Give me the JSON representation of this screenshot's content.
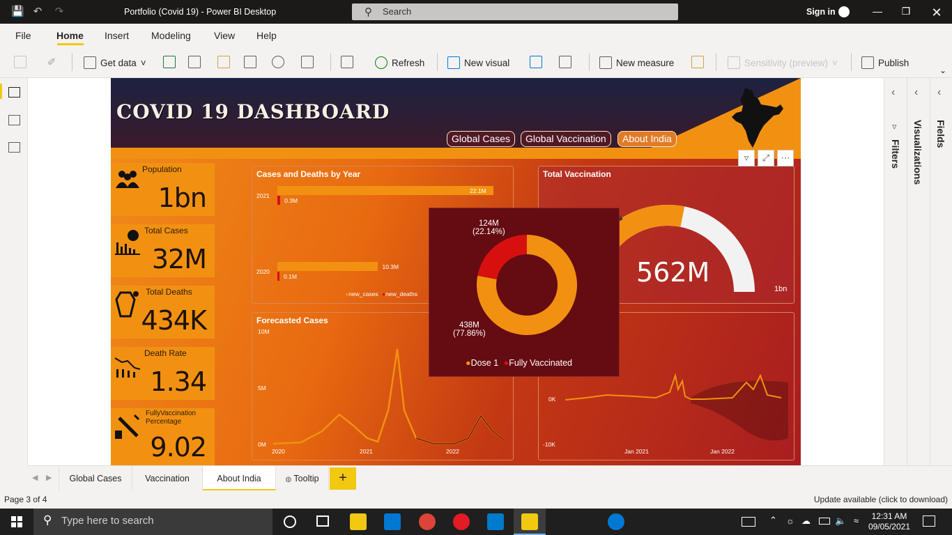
{
  "window": {
    "title": "Portfolio (Covid 19) - Power BI Desktop",
    "search_placeholder": "Search",
    "signin": "Sign in"
  },
  "menu": [
    "File",
    "Home",
    "Insert",
    "Modeling",
    "View",
    "Help"
  ],
  "ribbon": {
    "get_data": "Get data",
    "refresh": "Refresh",
    "new_visual": "New visual",
    "new_measure": "New measure",
    "sensitivity": "Sensitivity (preview)",
    "publish": "Publish"
  },
  "dashboard": {
    "title": "COVID 19 DASHBOARD",
    "nav": [
      "Global Cases",
      "Global Vaccination",
      "About India"
    ],
    "kpis": [
      {
        "label": "Population",
        "value": "1bn"
      },
      {
        "label": "Total Cases",
        "value": "32M"
      },
      {
        "label": "Total Deaths",
        "value": "434K"
      },
      {
        "label": "Death Rate",
        "value": "1.34"
      },
      {
        "label": "FullyVaccination Percentage",
        "value": "9.02"
      }
    ],
    "cases_deaths": {
      "title": "Cases and Deaths by Year",
      "years": [
        "2021",
        "2020"
      ],
      "new_cases_labels": [
        "22.1M",
        "10.3M"
      ],
      "new_deaths_labels": [
        "0.3M",
        "0.1M"
      ],
      "legend": [
        "new_cases",
        "new_deaths"
      ]
    },
    "total_vaccination": {
      "title": "Total Vaccination",
      "value": "562M",
      "max_label": "1bn"
    },
    "forecast": {
      "title": "Forecasted Cases",
      "yticks": [
        "10M",
        "5M",
        "0M"
      ],
      "xticks": [
        "2020",
        "2021",
        "2022"
      ]
    },
    "right_chart": {
      "yticks": [
        "0K",
        "-10K"
      ],
      "xticks": [
        "Jan 2021",
        "Jan 2022"
      ]
    },
    "tooltip": {
      "top_label": "124M",
      "top_pct": "(22.14%)",
      "bottom_label": "438M",
      "bottom_pct": "(77.86%)",
      "legend": [
        "Dose 1",
        "Fully Vaccinated"
      ]
    }
  },
  "colors": {
    "accent": "#f2c811",
    "orange": "#f29111",
    "red": "#d7100f",
    "dark_red": "#650b12"
  },
  "chart_data": [
    {
      "type": "bar",
      "title": "Cases and Deaths by Year",
      "categories": [
        "2021",
        "2020"
      ],
      "series": [
        {
          "name": "new_cases",
          "values": [
            22.1,
            10.3
          ]
        },
        {
          "name": "new_deaths",
          "values": [
            0.3,
            0.1
          ]
        }
      ],
      "unit": "M",
      "legend": "bottom-right"
    },
    {
      "type": "pie",
      "categories": [
        "Dose 1",
        "Fully Vaccinated"
      ],
      "values": [
        438,
        124
      ],
      "percentages": [
        77.86,
        22.14
      ],
      "unit": "M",
      "legend": "bottom"
    },
    {
      "type": "line",
      "title": "Forecasted Cases",
      "ylim": [
        0,
        10
      ],
      "unit": "M",
      "x": [
        "2020",
        "2021",
        "2022"
      ]
    }
  ],
  "side_panes": [
    "Filters",
    "Visualizations",
    "Fields"
  ],
  "tabs": [
    "Global Cases",
    "Vaccination",
    "About India",
    "Tooltip"
  ],
  "status": {
    "page": "Page 3 of 4",
    "update": "Update available (click to download)"
  },
  "taskbar": {
    "search": "Type here to search",
    "time": "12:31 AM",
    "date": "09/05/2021"
  }
}
